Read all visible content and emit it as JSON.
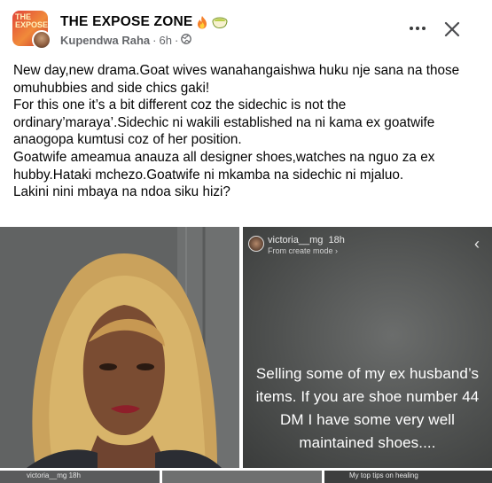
{
  "group": {
    "name": "THE EXPOSE ZONE",
    "avatar_text": "THE EXPOSE"
  },
  "meta": {
    "author": "Kupendwa Raha",
    "time": "6h",
    "separator": "·",
    "privacy_icon": "globe-icon"
  },
  "actions": {
    "more_icon": "more-icon",
    "close_icon": "close-icon"
  },
  "post": {
    "paragraphs": [
      "New day,new drama.Goat wives wanahangaishwa huku nje sana na those omuhubbies  and side chics gaki!",
      "For this one it’s a bit different coz the sidechic is not the ordinary’maraya’.Sidechic ni wakili established na ni kama ex goatwife anaogopa kumtusi coz of her position.",
      "Goatwife ameamua anauza all designer shoes,watches na nguo za ex hubby.Hataki mchezo.Goatwife ni mkamba na sidechic ni mjaluo.",
      "Lakini nini mbaya na ndoa siku hizi?"
    ]
  },
  "story": {
    "username": "victoria__mg",
    "age": "18h",
    "subtitle": "From create mode ›",
    "arrow": "‹",
    "caption_lines": [
      "Selling some of my ex husband’s",
      "items. If you are shoe number 44",
      "DM I have some very well",
      "maintained shoes...."
    ]
  },
  "strip": {
    "thumb1_label": "victoria__mg  18h",
    "thumb3_label": "My top tips on healing"
  },
  "colors": {
    "text_primary": "#050505",
    "text_secondary": "#65676b"
  }
}
